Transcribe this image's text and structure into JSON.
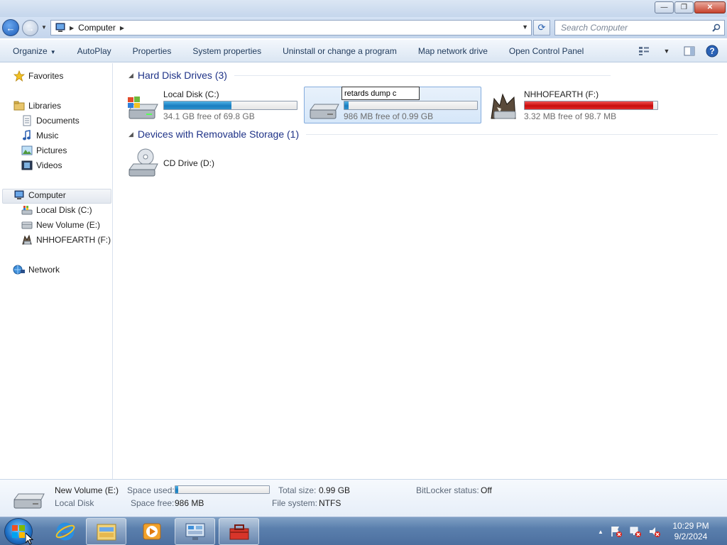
{
  "window": {
    "buttons": {
      "minimize": "—",
      "maximize": "❐",
      "close": "✕"
    }
  },
  "address_bar": {
    "location": "Computer",
    "search_placeholder": "Search Computer"
  },
  "command_bar": {
    "items": [
      "Organize",
      "AutoPlay",
      "Properties",
      "System properties",
      "Uninstall or change a program",
      "Map network drive",
      "Open Control Panel"
    ],
    "organize_caret": "▼"
  },
  "nav_pane": {
    "favorites": "Favorites",
    "libraries": "Libraries",
    "library_items": [
      "Documents",
      "Music",
      "Pictures",
      "Videos"
    ],
    "computer": "Computer",
    "computer_items": [
      "Local Disk (C:)",
      "New Volume (E:)",
      "NHHOFEARTH (F:)"
    ],
    "network": "Network"
  },
  "content": {
    "groups": [
      {
        "title": "Hard Disk Drives (3)"
      },
      {
        "title": "Devices with Removable Storage (1)"
      }
    ],
    "drives": [
      {
        "name": "Local Disk (C:)",
        "free_text": "34.1 GB free of 69.8 GB",
        "used_fraction": 0.51,
        "bar_color": "blue"
      },
      {
        "name": "New Volume (E:)",
        "rename_text": "retards dump c",
        "free_text": "986 MB free of 0.99 GB",
        "used_fraction": 0.03,
        "bar_color": "blue",
        "selected": true
      },
      {
        "name": "NHHOFEARTH (F:)",
        "free_text": "3.32 MB free of 98.7 MB",
        "used_fraction": 0.97,
        "bar_color": "red"
      }
    ],
    "removable": [
      {
        "name": "CD Drive (D:)"
      }
    ]
  },
  "details": {
    "name": "New Volume (E:)",
    "type": "Local Disk",
    "space_used_label": "Space used:",
    "space_used_fraction": 0.03,
    "space_free_label": "Space free:",
    "space_free": "986 MB",
    "total_size_label": "Total size:",
    "total_size": "0.99 GB",
    "file_system_label": "File system:",
    "file_system": "NTFS",
    "bitlocker_label": "BitLocker status:",
    "bitlocker": "Off"
  },
  "taskbar": {
    "time": "10:29 PM",
    "date": "9/2/2024",
    "tray_arrow": "▲"
  },
  "colors": {
    "accent_blue": "#1a7ec0",
    "critical_red": "#c80c0c",
    "group_header": "#1e3287",
    "selection": "#d6e7f9"
  }
}
